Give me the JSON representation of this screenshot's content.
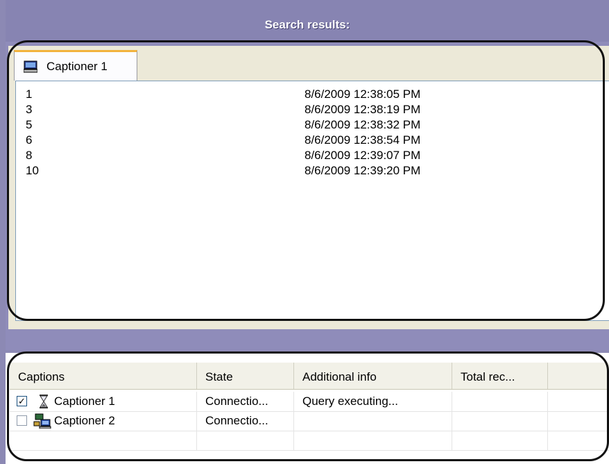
{
  "header": {
    "title": "Search results:"
  },
  "tab": {
    "label": "Captioner 1",
    "icon": "computer-icon"
  },
  "results": [
    {
      "num": "1",
      "time": "8/6/2009 12:38:05 PM"
    },
    {
      "num": "3",
      "time": "8/6/2009 12:38:19 PM"
    },
    {
      "num": "5",
      "time": "8/6/2009 12:38:32 PM"
    },
    {
      "num": "6",
      "time": "8/6/2009 12:38:54 PM"
    },
    {
      "num": "8",
      "time": "8/6/2009 12:39:07 PM"
    },
    {
      "num": "10",
      "time": "8/6/2009 12:39:20 PM"
    }
  ],
  "table": {
    "columns": [
      "Captions",
      "State",
      "Additional info",
      "Total rec..."
    ],
    "rows": [
      {
        "checked": true,
        "icon": "hourglass-icon",
        "caption": "Captioner 1",
        "state": "Connectio...",
        "info": "Query executing...",
        "total": ""
      },
      {
        "checked": false,
        "icon": "networked-computer-icon",
        "caption": "Captioner 2",
        "state": "Connectio...",
        "info": "",
        "total": ""
      }
    ]
  },
  "colors": {
    "titlebar": "#8784b2",
    "tab_accent": "#f2b33d",
    "panel": "#ece9d8"
  }
}
